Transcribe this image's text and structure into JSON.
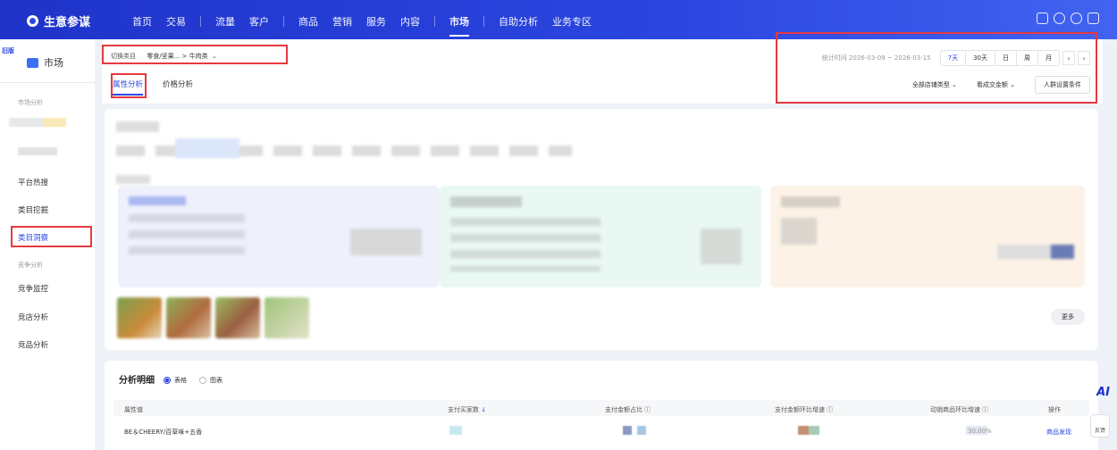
{
  "app": {
    "name": "生意参谋"
  },
  "nav": {
    "items": [
      "首页",
      "交易",
      "流量",
      "客户",
      "商品",
      "营销",
      "服务",
      "内容",
      "市场",
      "自助分析",
      "业务专区"
    ],
    "active": "市场"
  },
  "sidebar": {
    "corner_badge": "旧版",
    "title": "市场",
    "groups": [
      {
        "label": "市场分析",
        "items": [
          "平台热搜",
          "类目挖掘",
          "类目洞察"
        ]
      },
      {
        "label": "竞争分析",
        "items": [
          "竞争监控",
          "竞店分析",
          "竞品分析"
        ]
      }
    ],
    "active": "类目洞察"
  },
  "header": {
    "category_switch": "切换类目",
    "category_path": "零食/坚果... > 牛肉类",
    "tabs": [
      "属性分析",
      "价格分析"
    ],
    "active_tab": "属性分析",
    "stat_range": "统计时间 2026-03-09 ~ 2026-03-15",
    "periods": [
      "7天",
      "30天",
      "日",
      "周",
      "月"
    ],
    "active_period": "7天",
    "filter_shop_type": "全部店铺类型",
    "filter_metric": "看成交金额",
    "crowd_button": "人群设置条件"
  },
  "overview": {
    "more_button": "更多"
  },
  "detail": {
    "title": "分析明细",
    "view_options": [
      "表格",
      "图表"
    ],
    "active_view": "表格",
    "columns": [
      "属性值",
      "支付买家数",
      "支付金额占比",
      "支付金额环比增速",
      "动销商品环比增速",
      "操作"
    ],
    "rows": [
      {
        "attr": "BE＆CHEERY/百草味+五香",
        "growth_tail": "30.00%",
        "action": "商品发现"
      }
    ]
  },
  "floating": {
    "ai": "AI",
    "feedback": "反馈"
  },
  "colors": {
    "brand": "#2b46e0",
    "highlight": "#e53940"
  }
}
